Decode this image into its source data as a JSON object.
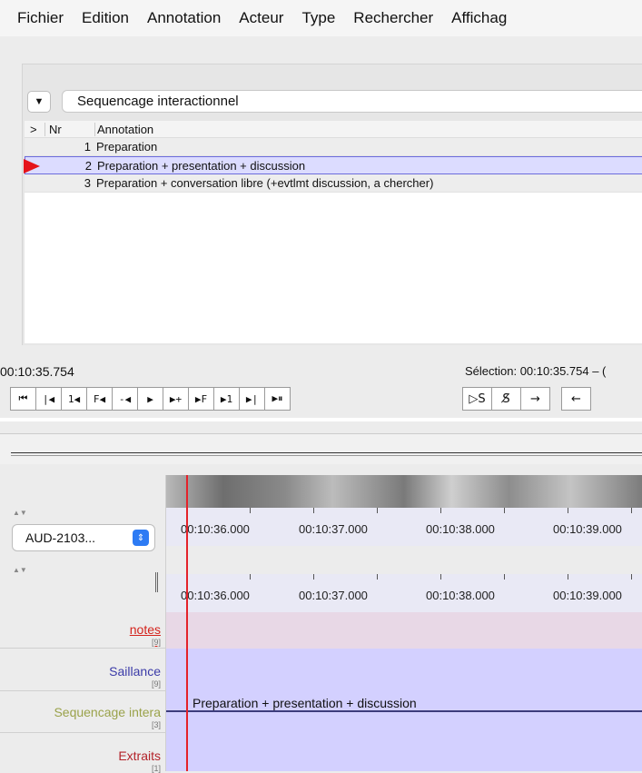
{
  "menu": [
    "Fichier",
    "Edition",
    "Annotation",
    "Acteur",
    "Type",
    "Rechercher",
    "Affichag"
  ],
  "tier_selector": {
    "drop_icon": "triangle-down-icon",
    "value": "Sequencage interactionnel"
  },
  "table": {
    "headers": [
      ">",
      "Nr",
      "Annotation"
    ],
    "rows": [
      {
        "nr": "1",
        "text": "Preparation"
      },
      {
        "nr": "2",
        "text": "Preparation + presentation + discussion"
      },
      {
        "nr": "3",
        "text": "Preparation + conversation libre (+evtlmt discussion, a chercher)"
      }
    ],
    "selected_row": 2
  },
  "player": {
    "current_time": "00:10:35.754",
    "selection": "Sélection: 00:10:35.754 – (",
    "buttons": [
      "⏮",
      "|◀",
      "1◀",
      "F◀",
      "-◀",
      "▶",
      "▶+",
      "▶F",
      "▶1",
      "▶|",
      "▶⏸"
    ],
    "buttons2": [
      "▷S",
      "S̸",
      "→",
      "←"
    ]
  },
  "timeline": {
    "audio_select": "AUD-2103...",
    "tick_labels": [
      "00:10:36.000",
      "00:10:37.000",
      "00:10:38.000",
      "00:10:39.000"
    ]
  },
  "tiers": [
    {
      "name": "notes",
      "count": "[9]",
      "color": "#d4231c"
    },
    {
      "name": "Saillance",
      "count": "[9]",
      "color": "#3b3ba8"
    },
    {
      "name": "Sequencage intera",
      "count": "[3]",
      "color": "#9aa24a"
    },
    {
      "name": "Extraits",
      "count": "[1]",
      "color": "#b3232a"
    }
  ],
  "annotation_label": "Preparation + presentation + discussion",
  "colors": {
    "selection": "#dcdcff",
    "lane": "#d3d0ff",
    "notes_lane": "#e8d8e6",
    "cursor": "#e4222a"
  }
}
